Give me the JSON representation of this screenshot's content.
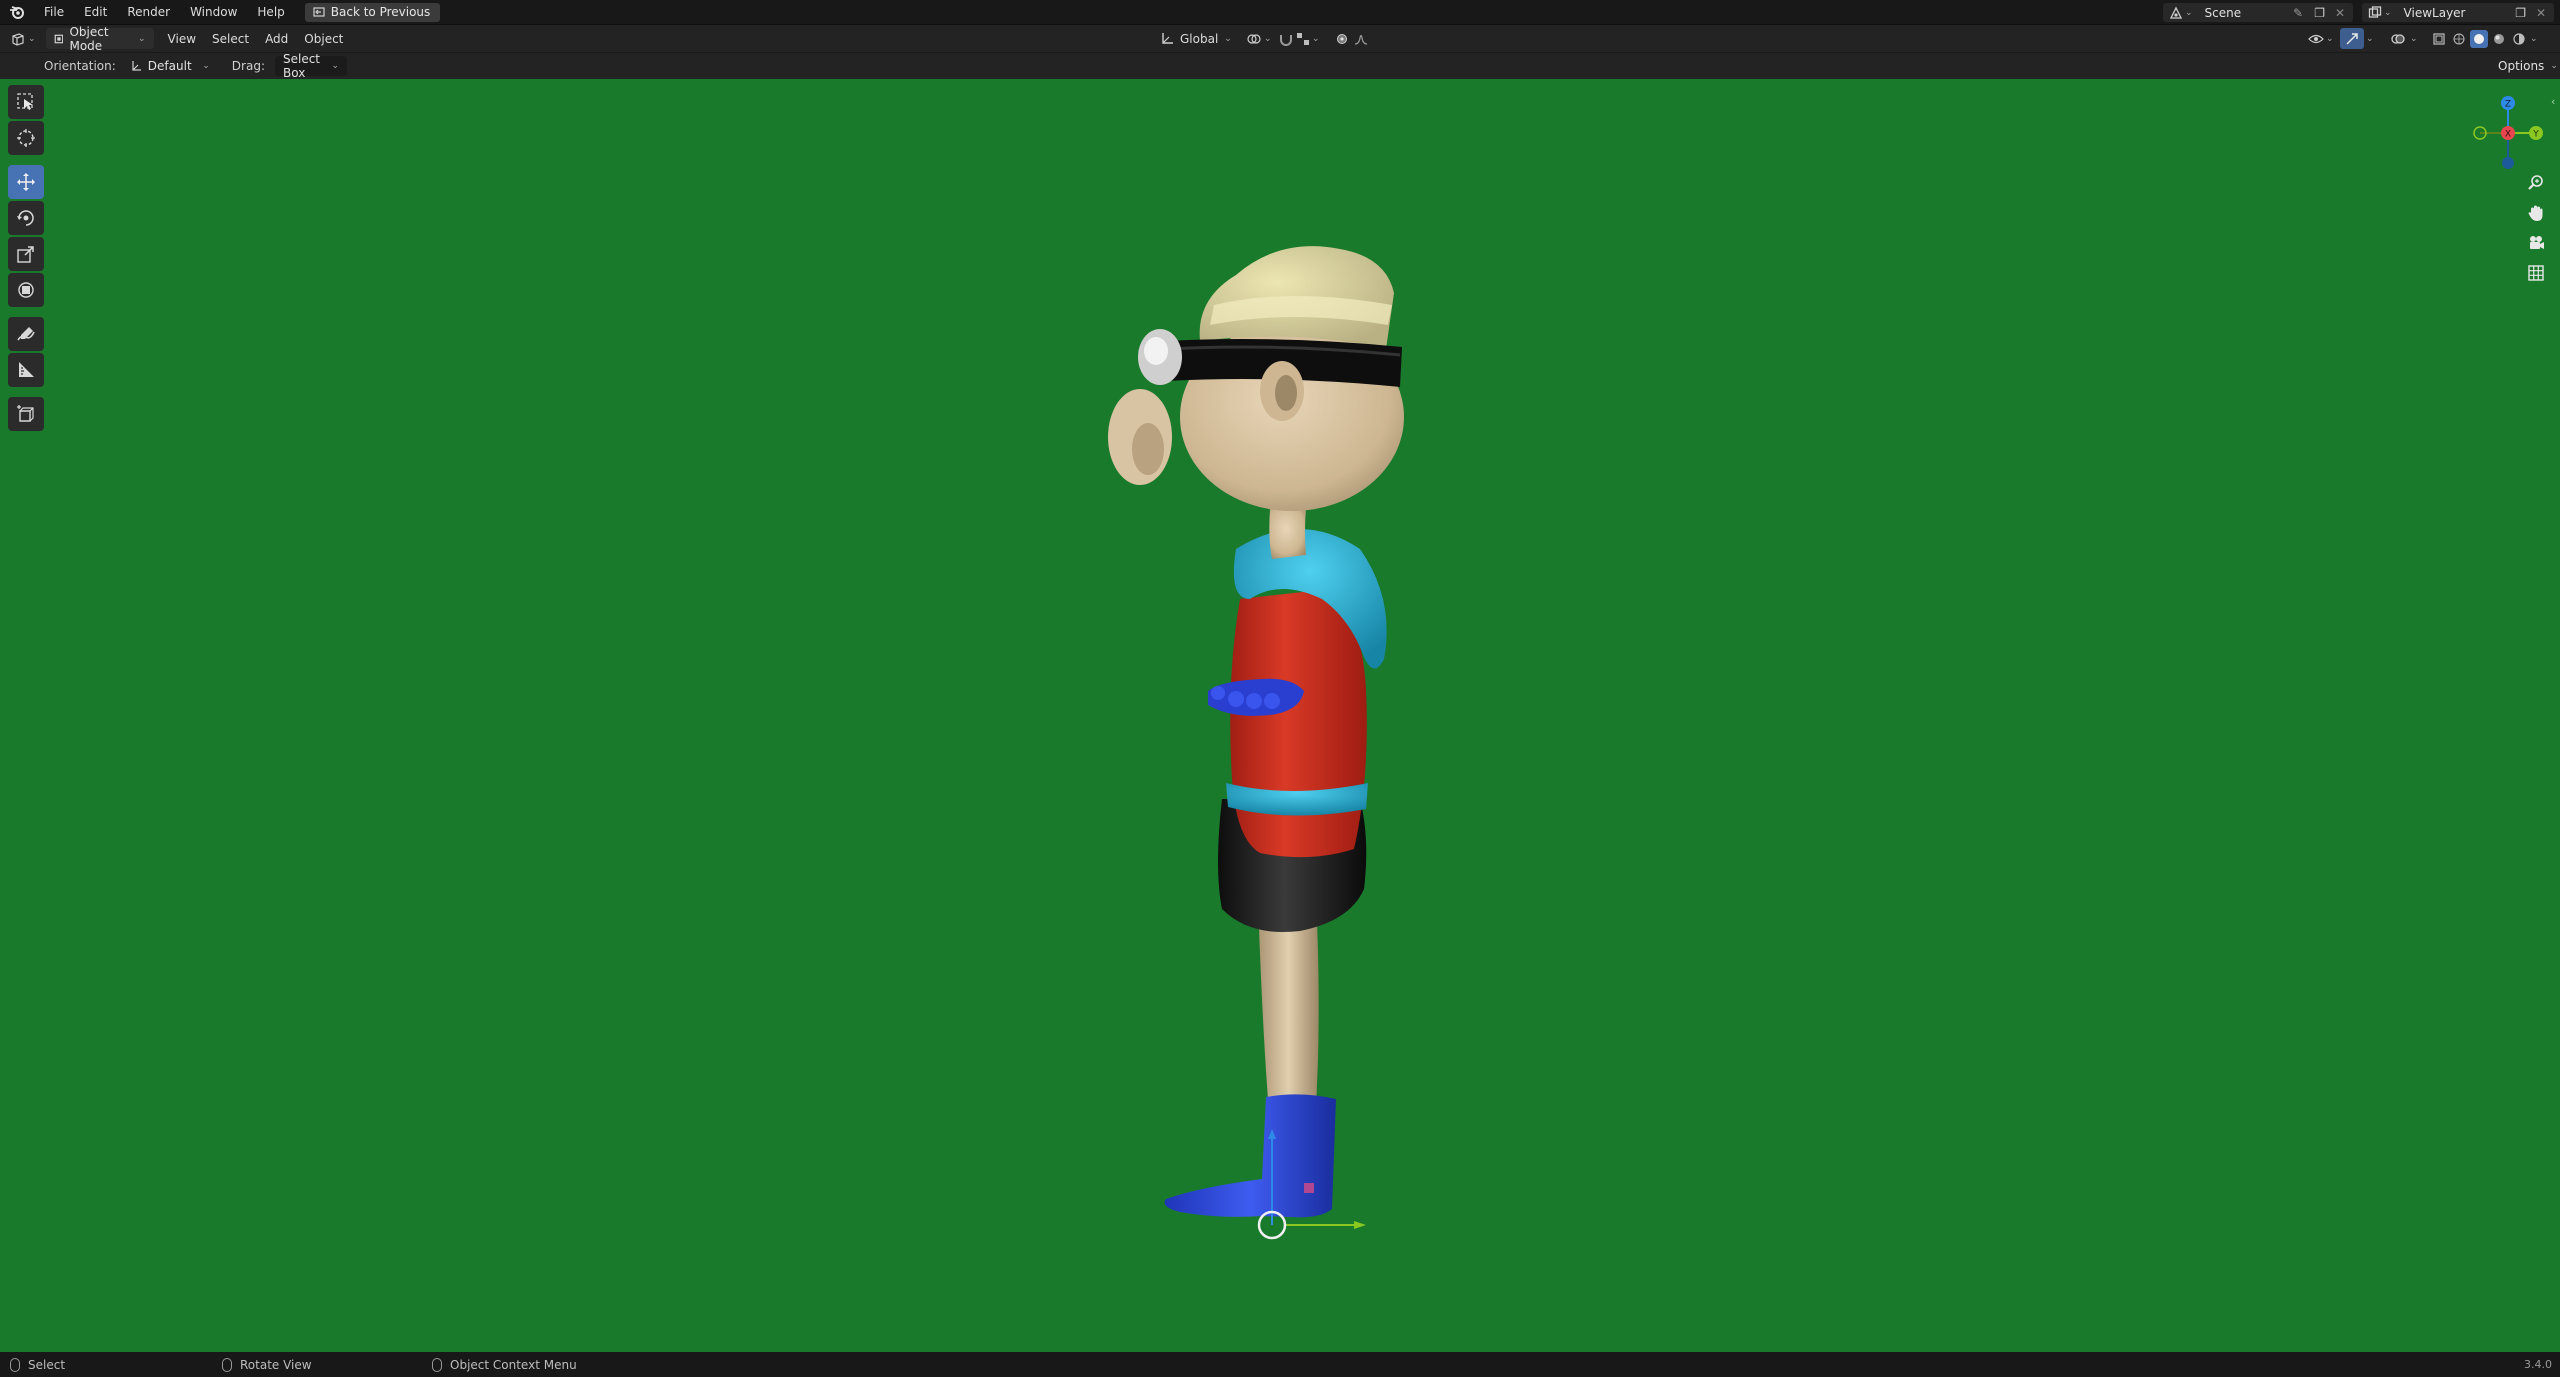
{
  "topbar": {
    "menus": [
      "File",
      "Edit",
      "Render",
      "Window",
      "Help"
    ],
    "back_button": "Back to Previous",
    "scene_name": "Scene",
    "view_layer_name": "ViewLayer"
  },
  "header": {
    "mode": "Object Mode",
    "menus": [
      "View",
      "Select",
      "Add",
      "Object"
    ],
    "transform_orientation": "Global"
  },
  "tool_settings": {
    "orientation_label": "Orientation:",
    "orientation_value": "Default",
    "drag_label": "Drag:",
    "drag_value": "Select Box",
    "options_label": "Options"
  },
  "toolbar": {
    "tools": [
      "select-box",
      "cursor",
      "move",
      "rotate",
      "scale",
      "transform",
      "annotate",
      "measure",
      "add-cube"
    ],
    "active_tool": "move"
  },
  "gizmo": {
    "axes": [
      "X",
      "Y",
      "Z"
    ]
  },
  "statusbar": {
    "select": "Select",
    "rotate_view": "Rotate View",
    "context_menu": "Object Context Menu",
    "version": "3.4.0"
  },
  "colors": {
    "viewport_bg": "#1a7a2c",
    "active_tool": "#4772b3",
    "axis_x": "#e8464e",
    "axis_y": "#8ac721",
    "axis_z": "#2d8ae6"
  }
}
